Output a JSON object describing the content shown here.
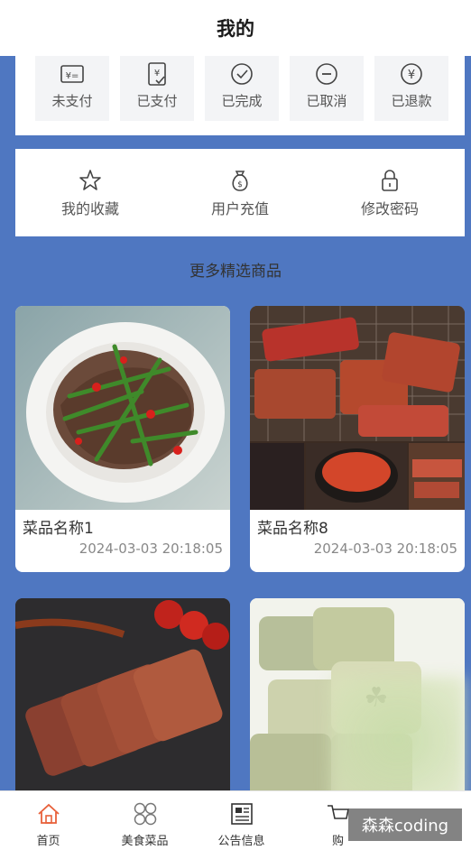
{
  "header": {
    "title": "我的"
  },
  "orders": [
    {
      "label": "未支付",
      "icon": "unpaid-icon"
    },
    {
      "label": "已支付",
      "icon": "paid-icon"
    },
    {
      "label": "已完成",
      "icon": "completed-icon"
    },
    {
      "label": "已取消",
      "icon": "cancelled-icon"
    },
    {
      "label": "已退款",
      "icon": "refunded-icon"
    }
  ],
  "functions": [
    {
      "label": "我的收藏",
      "icon": "star-icon"
    },
    {
      "label": "用户充值",
      "icon": "money-bag-icon"
    },
    {
      "label": "修改密码",
      "icon": "lock-icon"
    }
  ],
  "section": {
    "title": "更多精选商品"
  },
  "products": [
    {
      "name": "菜品名称1",
      "time": "2024-03-03 20:18:05"
    },
    {
      "name": "菜品名称8",
      "time": "2024-03-03 20:18:05"
    },
    {
      "name": "",
      "time": ""
    },
    {
      "name": "",
      "time": ""
    }
  ],
  "tabbar": [
    {
      "label": "首页",
      "icon": "home-icon"
    },
    {
      "label": "美食菜品",
      "icon": "grid-icon"
    },
    {
      "label": "公告信息",
      "icon": "newspaper-icon"
    },
    {
      "label": "购",
      "icon": "cart-icon"
    }
  ],
  "watermark": "森森coding",
  "colors": {
    "background": "#4f77c1",
    "card": "#ffffff",
    "accent": "#e8603a"
  }
}
